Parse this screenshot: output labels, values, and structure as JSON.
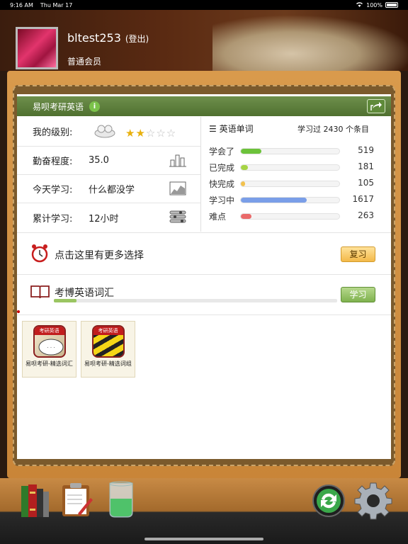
{
  "status": {
    "time": "9:16 AM",
    "date": "Thu Mar 17",
    "battery": "100%"
  },
  "header": {
    "username": "bltest253",
    "logout": "(登出)",
    "membership": "普通会员"
  },
  "panel": {
    "title": "易呗考研英语"
  },
  "stats": {
    "level_label": "我的级别:",
    "level_stars": {
      "on": "★★",
      "off": "☆☆☆",
      "count": 2,
      "max": 5
    },
    "diligence_label": "勤奋程度:",
    "diligence_value": "35.0",
    "today_label": "今天学习:",
    "today_value": "什么都没学",
    "total_label": "累计学习:",
    "total_value": "12小时"
  },
  "words": {
    "title": "英语单词",
    "summary": "学习过 2430 个条目",
    "rows": [
      {
        "label": "学会了",
        "value": "519",
        "fraction": 0.21,
        "color": "#6cc23a"
      },
      {
        "label": "已完成",
        "value": "181",
        "fraction": 0.07,
        "color": "#a6d445"
      },
      {
        "label": "快完成",
        "value": "105",
        "fraction": 0.04,
        "color": "#f2c14e"
      },
      {
        "label": "学习中",
        "value": "1617",
        "fraction": 0.67,
        "color": "#7a9ee8"
      },
      {
        "label": "难点",
        "value": "263",
        "fraction": 0.11,
        "color": "#ea6a6a"
      }
    ]
  },
  "more": {
    "text": "点击这里有更多选择",
    "button": "复习"
  },
  "course": {
    "title": "考博英语词汇",
    "button": "学习",
    "progress": 0.08
  },
  "tiles": [
    {
      "badge": "考研英语",
      "caption": "易呗考研-精选词汇"
    },
    {
      "badge": "考研英语",
      "caption": "易呗考研-精选词组"
    }
  ]
}
